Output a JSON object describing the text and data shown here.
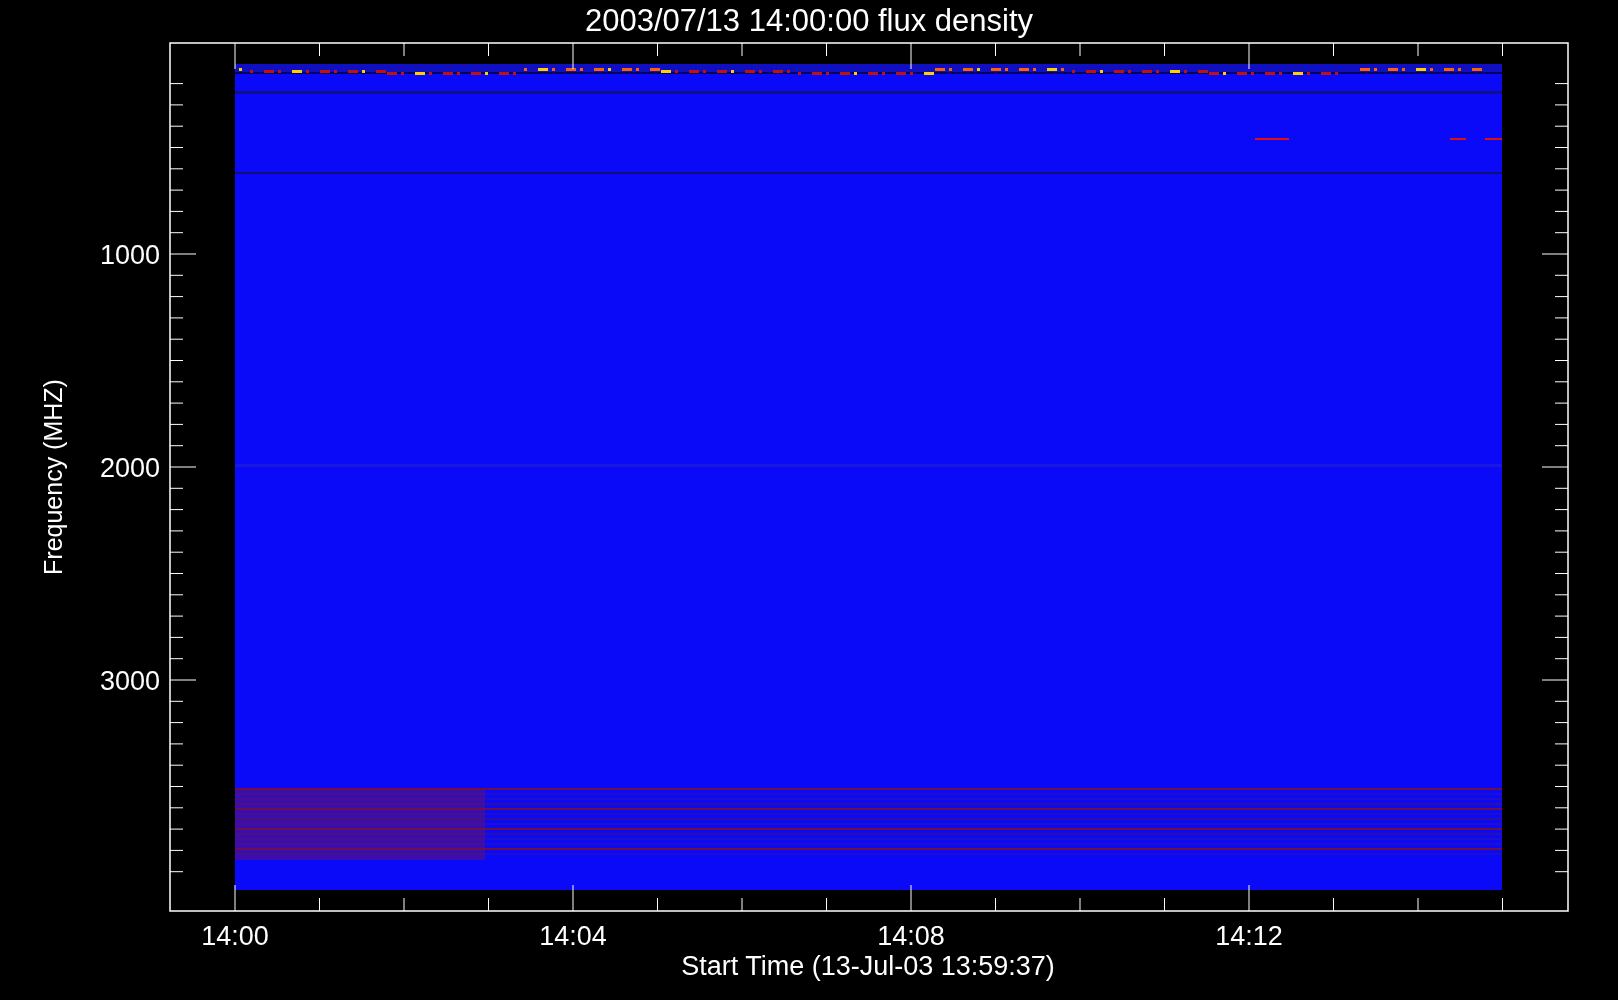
{
  "title": "2003/07/13 14:00:00 flux density",
  "y_axis": {
    "label": "Frequency (MHZ)",
    "ticks": [
      "1000",
      "2000",
      "3000"
    ]
  },
  "x_axis": {
    "label": "Start Time (13-Jul-03 13:59:37)",
    "ticks": [
      "14:00",
      "14:04",
      "14:08",
      "14:12"
    ]
  }
}
